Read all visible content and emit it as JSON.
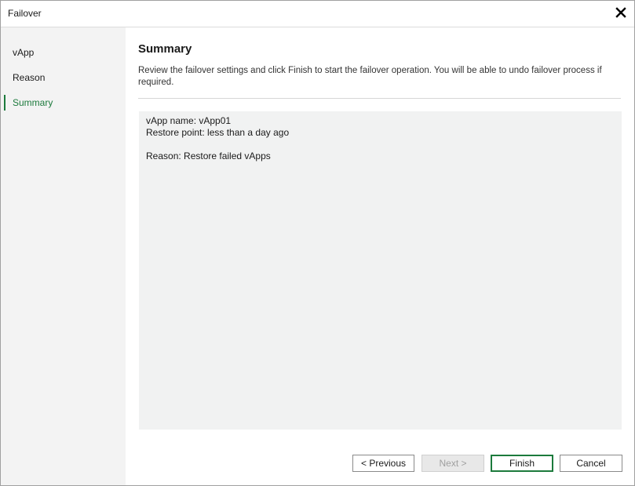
{
  "window": {
    "title": "Failover",
    "close_icon": "close-icon"
  },
  "sidebar": {
    "items": [
      {
        "label": "vApp",
        "active": false
      },
      {
        "label": "Reason",
        "active": false
      },
      {
        "label": "Summary",
        "active": true
      }
    ]
  },
  "main": {
    "title": "Summary",
    "description": "Review the failover settings and click Finish to start the failover operation. You will be able to undo failover process if required.",
    "summary_lines": [
      "vApp name: vApp01",
      "Restore point: less than a day ago",
      "",
      "Reason: Restore failed vApps"
    ]
  },
  "buttons": {
    "previous": "< Previous",
    "next": "Next >",
    "finish": "Finish",
    "cancel": "Cancel"
  },
  "colors": {
    "accent": "#1c7a3c",
    "sidebar_bg": "#f3f3f3",
    "summary_bg": "#f1f2f2"
  }
}
